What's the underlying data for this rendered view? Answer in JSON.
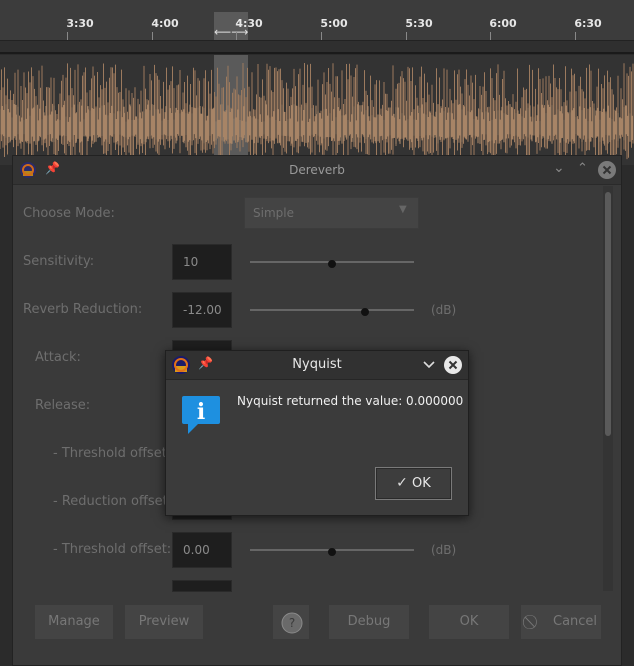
{
  "timeline": {
    "ticks": [
      "3:30",
      "4:00",
      "4:30",
      "5:00",
      "5:30",
      "6:00",
      "6:30"
    ]
  },
  "colors": {
    "waveform": "#9c7a5e",
    "waveform_rms": "#b28e6e",
    "info_blue": "#1e90e0"
  },
  "dereverb": {
    "title": "Dereverb",
    "rows": [
      {
        "label": "Choose Mode:",
        "value": "Simple",
        "unit": ""
      },
      {
        "label": "Sensitivity:",
        "value": "10",
        "unit": ""
      },
      {
        "label": "Reverb Reduction:",
        "value": "-12.00",
        "unit": "(dB)"
      },
      {
        "label": "Attack:",
        "value": "",
        "unit": ""
      },
      {
        "label": "Release:",
        "value": "",
        "unit": ""
      },
      {
        "label": "- Threshold offset:",
        "value": "",
        "unit": ""
      },
      {
        "label": "- Reduction offset:",
        "value": "",
        "unit": ""
      },
      {
        "label": "- Threshold offset:",
        "value": "0.00",
        "unit": "(dB)"
      }
    ],
    "buttons": {
      "manage": "Manage",
      "preview": "Preview",
      "debug": "Debug",
      "ok": "OK",
      "cancel": "Cancel"
    }
  },
  "nyquist": {
    "title": "Nyquist",
    "message": "Nyquist returned the value: 0.000000",
    "ok_label": "OK",
    "icon": "info-icon"
  }
}
